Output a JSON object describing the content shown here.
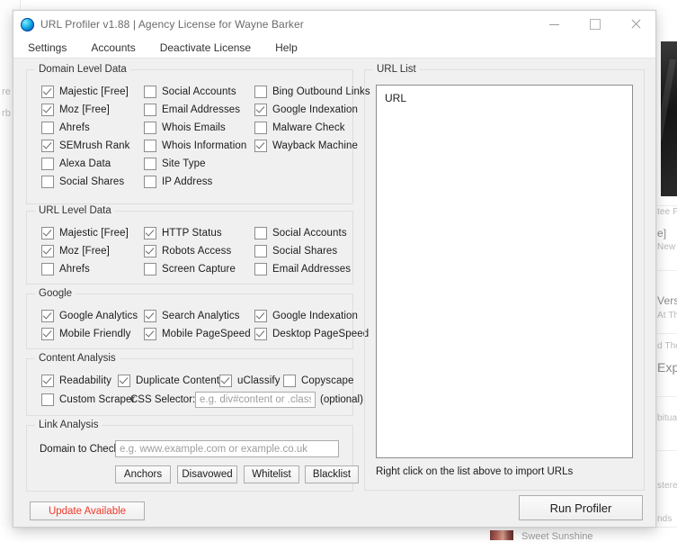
{
  "window": {
    "title": "URL Profiler v1.88 | Agency License for Wayne Barker",
    "icon": "app-circle-icon",
    "controls": {
      "minimize": "minimize-icon",
      "maximize": "maximize-icon",
      "close": "close-icon"
    }
  },
  "menu": {
    "items": [
      {
        "label": "Settings"
      },
      {
        "label": "Accounts"
      },
      {
        "label": "Deactivate License"
      },
      {
        "label": "Help"
      }
    ]
  },
  "groups": {
    "domain_level_data": {
      "title": "Domain Level Data",
      "columns": [
        [
          {
            "label": "Majestic [Free]",
            "checked": true
          },
          {
            "label": "Moz [Free]",
            "checked": true
          },
          {
            "label": "Ahrefs",
            "checked": false
          },
          {
            "label": "SEMrush Rank",
            "checked": true
          },
          {
            "label": "Alexa Data",
            "checked": false
          },
          {
            "label": "Social Shares",
            "checked": false
          }
        ],
        [
          {
            "label": "Social Accounts",
            "checked": false
          },
          {
            "label": "Email Addresses",
            "checked": false
          },
          {
            "label": "Whois Emails",
            "checked": false
          },
          {
            "label": "Whois Information",
            "checked": false
          },
          {
            "label": "Site Type",
            "checked": false
          },
          {
            "label": "IP Address",
            "checked": false
          }
        ],
        [
          {
            "label": "Bing Outbound Links",
            "checked": false
          },
          {
            "label": "Google Indexation",
            "checked": true
          },
          {
            "label": "Malware Check",
            "checked": false
          },
          {
            "label": "Wayback Machine",
            "checked": true
          }
        ]
      ]
    },
    "url_level_data": {
      "title": "URL Level Data",
      "columns": [
        [
          {
            "label": "Majestic [Free]",
            "checked": true
          },
          {
            "label": "Moz [Free]",
            "checked": true
          },
          {
            "label": "Ahrefs",
            "checked": false
          }
        ],
        [
          {
            "label": "HTTP Status",
            "checked": true
          },
          {
            "label": "Robots Access",
            "checked": true
          },
          {
            "label": "Screen Capture",
            "checked": false
          }
        ],
        [
          {
            "label": "Social Accounts",
            "checked": false
          },
          {
            "label": "Social Shares",
            "checked": false
          },
          {
            "label": "Email Addresses",
            "checked": false
          }
        ]
      ]
    },
    "google": {
      "title": "Google",
      "columns": [
        [
          {
            "label": "Google Analytics",
            "checked": true
          },
          {
            "label": "Mobile Friendly",
            "checked": true
          }
        ],
        [
          {
            "label": "Search Analytics",
            "checked": true
          },
          {
            "label": "Mobile PageSpeed",
            "checked": true
          }
        ],
        [
          {
            "label": "Google Indexation",
            "checked": true
          },
          {
            "label": "Desktop PageSpeed",
            "checked": true
          }
        ]
      ]
    },
    "content_analysis": {
      "title": "Content Analysis",
      "row1": [
        {
          "label": "Readability",
          "checked": true
        },
        {
          "label": "Duplicate Content",
          "checked": true
        },
        {
          "label": "uClassify",
          "checked": true
        },
        {
          "label": "Copyscape",
          "checked": false
        }
      ],
      "row2": {
        "custom_scraper": {
          "label": "Custom Scraper",
          "checked": false
        },
        "css_selector_label": "CSS Selector:",
        "css_selector_value": "",
        "css_selector_placeholder": "e.g. div#content or .class-na",
        "optional_note": "(optional)"
      }
    },
    "link_analysis": {
      "title": "Link Analysis",
      "domain_label": "Domain to Check:",
      "domain_value": "",
      "domain_placeholder": "e.g. www.example.com or example.co.uk",
      "buttons": [
        {
          "label": "Anchors"
        },
        {
          "label": "Disavowed"
        },
        {
          "label": "Whitelist"
        },
        {
          "label": "Blacklist"
        }
      ]
    },
    "url_list": {
      "title": "URL List",
      "first_entry": "URL",
      "hint": "Right click on the list above to import URLs"
    }
  },
  "footer": {
    "update_button": "Update Available",
    "update_color": "#f0392b",
    "run_button": "Run Profiler"
  },
  "background": {
    "left_fragments": [
      "re",
      "rb"
    ],
    "right_fragments": [
      "tee P",
      "e]",
      "New",
      "Versi",
      "At Th",
      "d The",
      "Exp",
      "bitua",
      "stere",
      "nds"
    ],
    "bottom_item": "Sweet Sunshine"
  }
}
